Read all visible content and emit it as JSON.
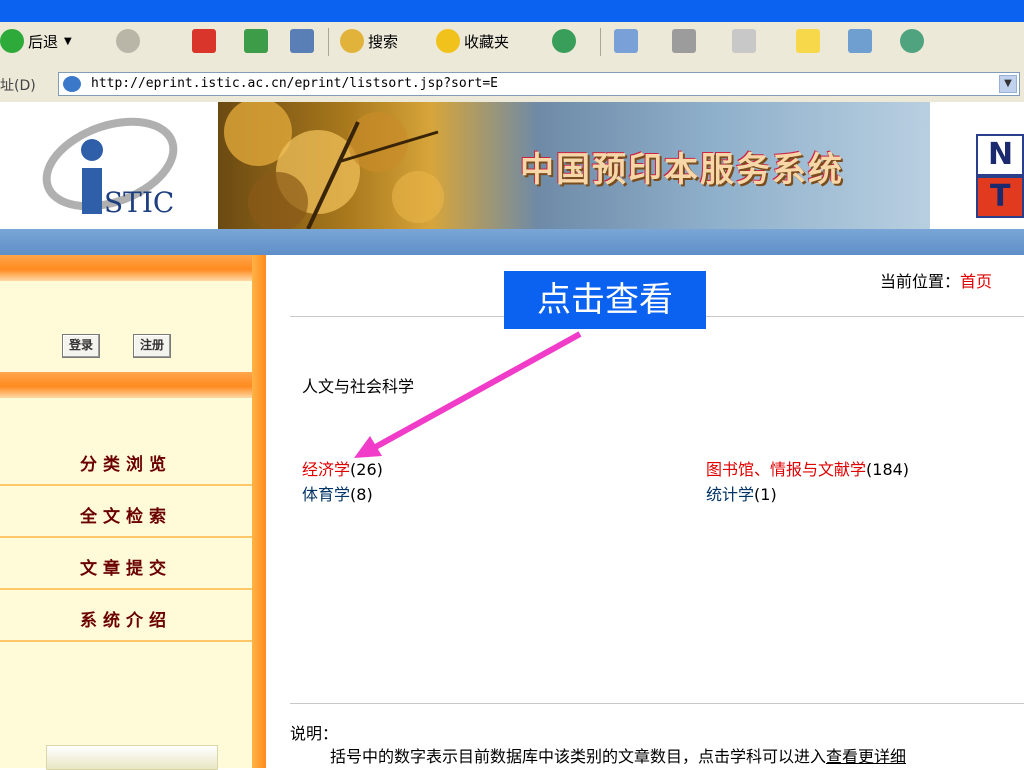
{
  "toolbar": {
    "back_label": "后退",
    "search_label": "搜索",
    "favorites_label": "收藏夹"
  },
  "address_bar": {
    "label": "址(D)",
    "url": "http://eprint.istic.ac.cn/eprint/listsort.jsp?sort=E"
  },
  "banner": {
    "logo_text": "STIC",
    "title": "中国预印本服务系统",
    "right_logo_letters": [
      "N",
      "T"
    ]
  },
  "sidebar": {
    "login_label": "登录",
    "register_label": "注册",
    "nav": [
      "分类浏览",
      "全文检索",
      "文章提交",
      "系统介绍"
    ]
  },
  "main": {
    "location_label": "当前位置：",
    "location_home": "首页",
    "section_title": "人文与社会科学",
    "categories": [
      {
        "name": "经济学",
        "count": "(26)",
        "highlight": true
      },
      {
        "name": "图书馆、情报与文献学",
        "count": "(184)",
        "highlight": true
      },
      {
        "name": "体育学",
        "count": "(8)",
        "highlight": false
      },
      {
        "name": "统计学",
        "count": "(1)",
        "highlight": false
      }
    ],
    "note_label": "说明：",
    "note_text": "括号中的数字表示目前数据库中该类别的文章数目，点击学科可以进入",
    "note_link": "查看更详细"
  },
  "annotation": {
    "callout_text": "点击查看",
    "callout_color": "#0b61f0",
    "arrow_color": "#f03cc8"
  },
  "colors": {
    "link_red": "#e00000",
    "sidebar_bg": "#fffad7",
    "accent_orange": "#ff8a1f"
  }
}
